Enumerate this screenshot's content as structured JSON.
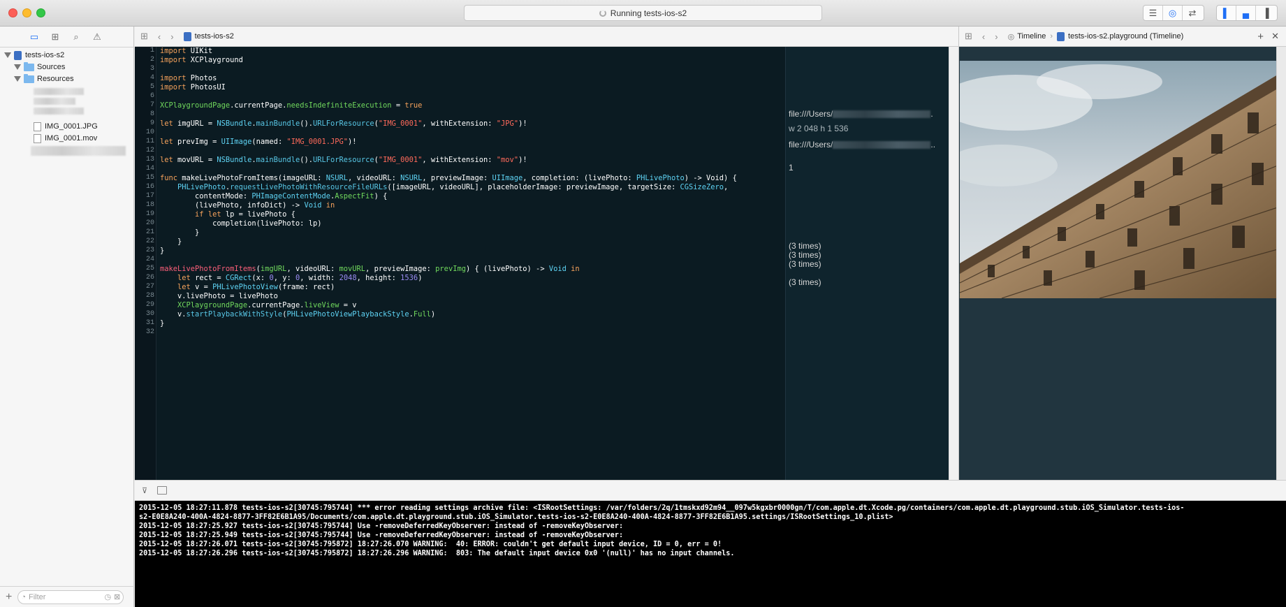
{
  "window": {
    "activity_text": "Running tests-ios-s2"
  },
  "navigator": {
    "project": "tests-ios-s2",
    "folders": [
      "Sources",
      "Resources"
    ],
    "files": [
      "IMG_0001.JPG",
      "IMG_0001.mov"
    ],
    "filter_placeholder": "Filter"
  },
  "editor": {
    "breadcrumb": "tests-ios-s2",
    "line_numbers": [
      "1",
      "2",
      "3",
      "4",
      "5",
      "6",
      "7",
      "8",
      "9",
      "10",
      "11",
      "12",
      "13",
      "14",
      "15",
      "16",
      "17",
      "18",
      "19",
      "20",
      "21",
      "22",
      "23",
      "24",
      "25",
      "26",
      "27",
      "28",
      "29",
      "30",
      "31",
      "32"
    ]
  },
  "results": {
    "r9": "file:///Users/",
    "r9_tail": ".",
    "r11": "w 2 048 h 1 536",
    "r13": "file:///Users/",
    "r13_tail": "..",
    "r16": "1",
    "r25": "(3 times)",
    "r26": "(3 times)",
    "r27": "(3 times)",
    "r29": "(3 times)"
  },
  "assistant": {
    "timeline": "Timeline",
    "file": "tests-ios-s2.playground (Timeline)"
  },
  "console": {
    "lines": [
      "2015-12-05 18:27:11.878 tests-ios-s2[30745:795744] *** error reading settings archive file: <ISRootSettings: /var/folders/2q/1tmskxd92m94__097w5kgxbr0000gn/T/com.apple.dt.Xcode.pg/containers/com.apple.dt.playground.stub.iOS_Simulator.tests-ios-",
      "s2-E0E8A240-400A-4824-8877-3FF82E6B1A95/Documents/com.apple.dt.playground.stub.iOS_Simulator.tests-ios-s2-E0E8A240-400A-4824-8877-3FF82E6B1A95.settings/ISRootSettings_10.plist>",
      "2015-12-05 18:27:25.927 tests-ios-s2[30745:795744] Use -removeDeferredKeyObserver: instead of -removeKeyObserver:",
      "2015-12-05 18:27:25.949 tests-ios-s2[30745:795744] Use -removeDeferredKeyObserver: instead of -removeKeyObserver:",
      "2015-12-05 18:27:26.071 tests-ios-s2[30745:795872] 18:27:26.070 WARNING:  40: ERROR: couldn't get default input device, ID = 0, err = 0!",
      "2015-12-05 18:27:26.296 tests-ios-s2[30745:795872] 18:27:26.296 WARNING:  803: The default input device 0x0 '(null)' has no input channels."
    ]
  }
}
